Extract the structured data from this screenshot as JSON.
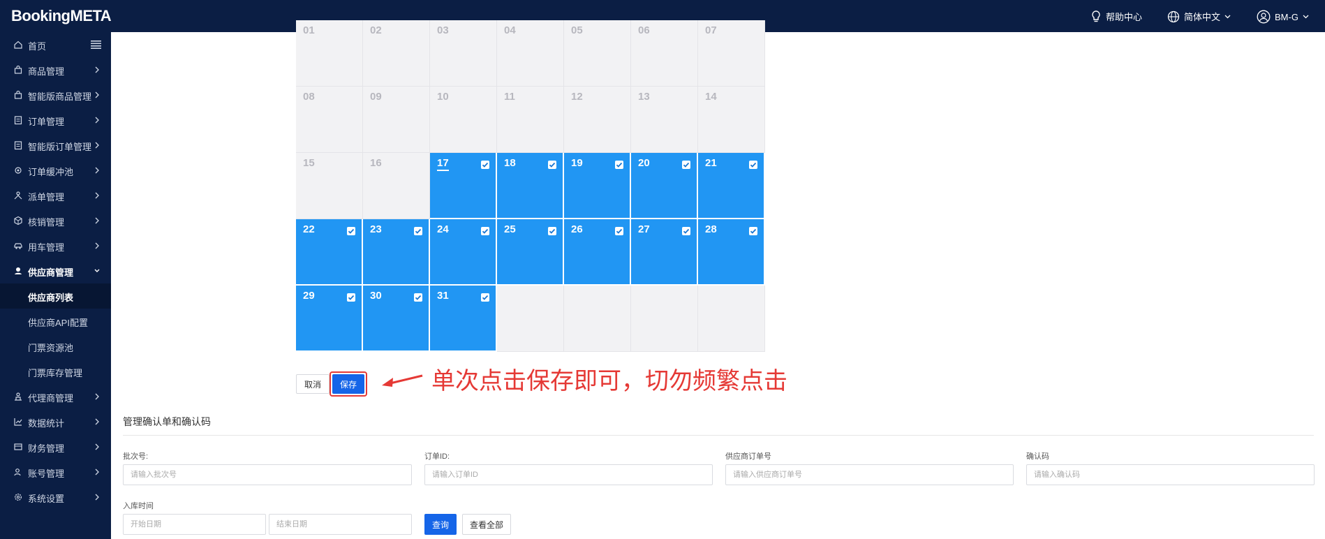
{
  "header": {
    "logo": "BookingMETA",
    "help": "帮助中心",
    "language": "简体中文",
    "user": "BM-G"
  },
  "sidebar": {
    "items": [
      {
        "label": "首页",
        "icon": "home-icon"
      },
      {
        "label": "商品管理",
        "icon": "bag-icon"
      },
      {
        "label": "智能版商品管理",
        "icon": "bag-icon"
      },
      {
        "label": "订单管理",
        "icon": "clipboard-icon"
      },
      {
        "label": "智能版订单管理",
        "icon": "clipboard-icon"
      },
      {
        "label": "订单缓冲池",
        "icon": "gear-icon"
      },
      {
        "label": "派单管理",
        "icon": "dispatch-icon"
      },
      {
        "label": "核销管理",
        "icon": "cube-icon"
      },
      {
        "label": "用车管理",
        "icon": "car-icon"
      },
      {
        "label": "供应商管理",
        "icon": "supplier-icon"
      },
      {
        "label": "代理商管理",
        "icon": "agent-icon"
      },
      {
        "label": "数据统计",
        "icon": "chart-icon"
      },
      {
        "label": "财务管理",
        "icon": "finance-icon"
      },
      {
        "label": "账号管理",
        "icon": "account-icon"
      },
      {
        "label": "系统设置",
        "icon": "settings-icon"
      }
    ],
    "supplier_sub": [
      {
        "label": "供应商列表"
      },
      {
        "label": "供应商API配置"
      },
      {
        "label": "门票资源池"
      },
      {
        "label": "门票库存管理"
      }
    ]
  },
  "calendar": {
    "disabled_days": [
      "01",
      "02",
      "03",
      "04",
      "05",
      "06",
      "07",
      "08",
      "09",
      "10",
      "11",
      "12",
      "13",
      "14",
      "15",
      "16"
    ],
    "selected_days": [
      "17",
      "18",
      "19",
      "20",
      "21",
      "22",
      "23",
      "24",
      "25",
      "26",
      "27",
      "28",
      "29",
      "30",
      "31"
    ],
    "today": "17"
  },
  "actions": {
    "cancel": "取消",
    "save": "保存"
  },
  "annotation": "单次点击保存即可，切勿频繁点击",
  "confirm_section": {
    "title": "管理确认单和确认码",
    "fields": [
      {
        "label": "批次号:",
        "placeholder": "请输入批次号"
      },
      {
        "label": "订单ID:",
        "placeholder": "请输入订单ID"
      },
      {
        "label": "供应商订单号",
        "placeholder": "请输入供应商订单号"
      },
      {
        "label": "确认码",
        "placeholder": "请输入确认码"
      }
    ],
    "date_label": "入库时间",
    "start_placeholder": "开始日期",
    "end_placeholder": "结束日期",
    "query": "查询",
    "view_all": "查看全部"
  },
  "colors": {
    "nav_bg": "#0b1e44",
    "selected_day": "#2196f3",
    "primary": "#1565e8",
    "annotation": "#e53935"
  }
}
